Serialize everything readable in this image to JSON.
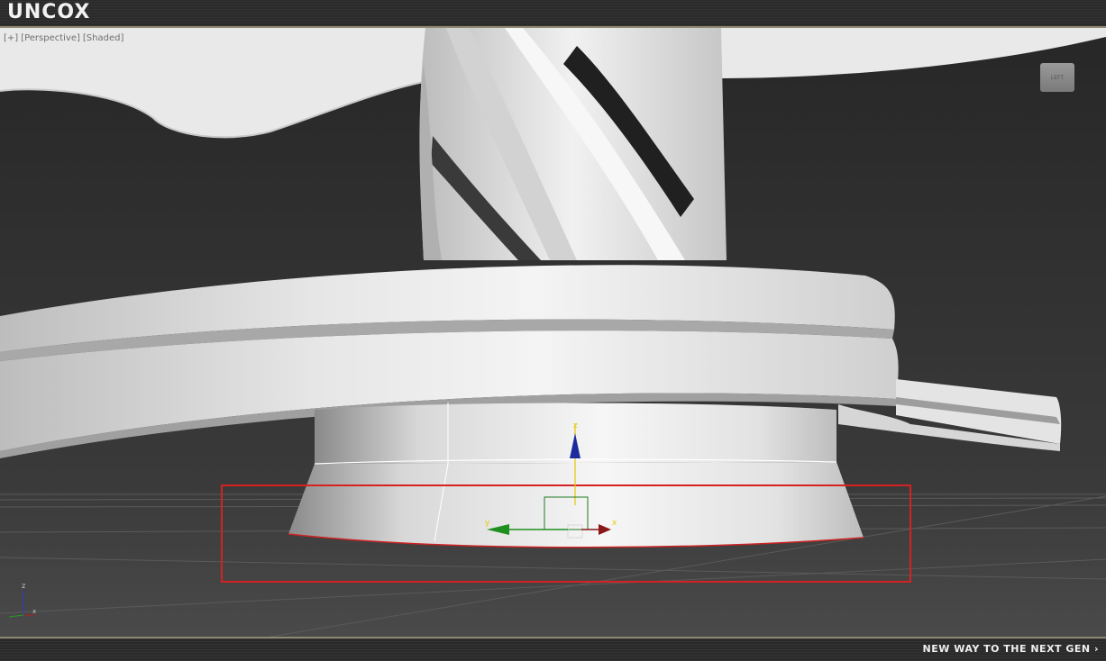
{
  "app": {
    "logo_text": "UNCOX"
  },
  "viewport": {
    "label_plus": "[+]",
    "label_view": "[Perspective]",
    "label_shading": "[Shaded]",
    "viewcube_label": "LEFT"
  },
  "gizmo": {
    "z_label": "z",
    "y_label": "y",
    "x_label": "x"
  },
  "world_axes": {
    "z_label": "z",
    "x_label": "x"
  },
  "footer": {
    "tagline": "NEW WAY TO THE NEXT GEN ›"
  },
  "colors": {
    "selection_box": "#d42222",
    "axis_z": "#1c2a9c",
    "axis_y": "#1f8f1f",
    "axis_x": "#8a1818",
    "frame_accent": "#8f8870"
  }
}
